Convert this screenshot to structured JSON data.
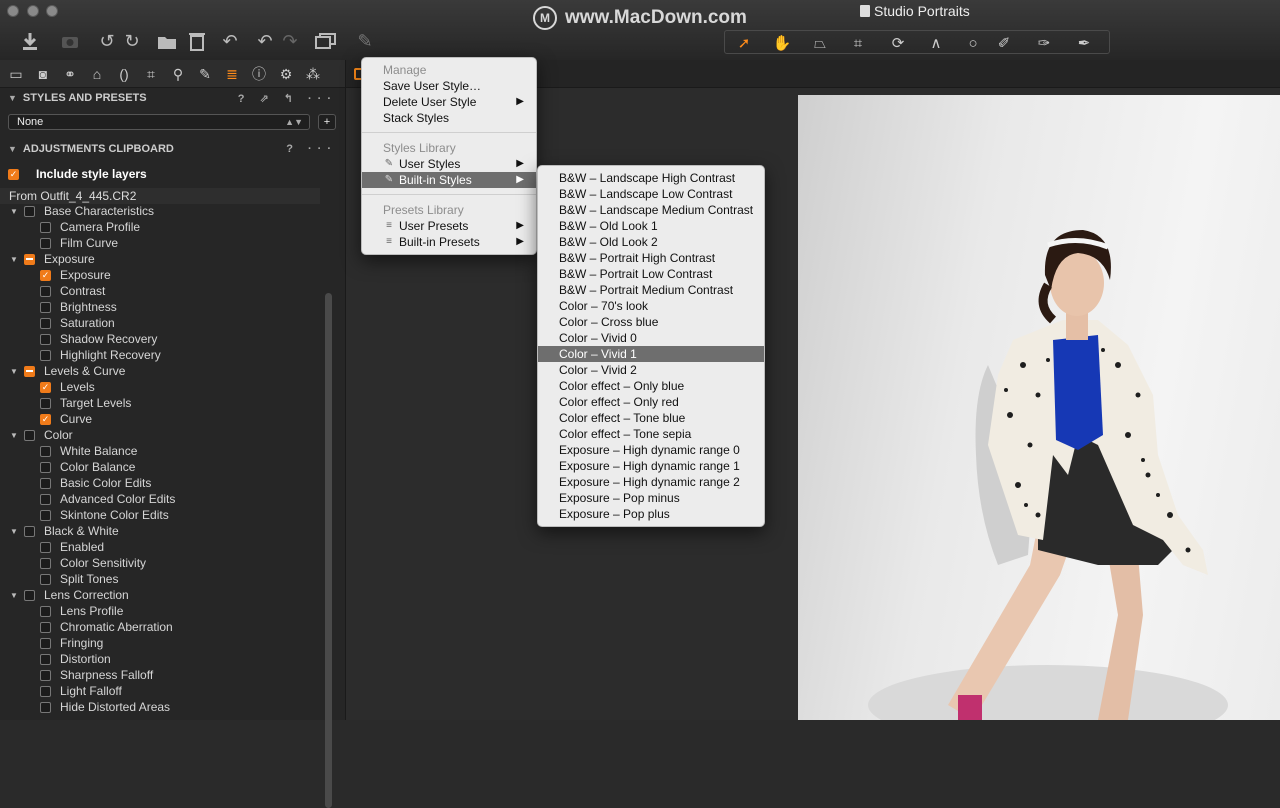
{
  "window": {
    "watermark": "www.MacDown.com",
    "watermark_logo": "M",
    "session_title": "Studio Portraits"
  },
  "toolbar_icons": [
    "import-icon",
    "camera-icon",
    "rotate-left-icon",
    "rotate-right-icon",
    "move-to-folder-icon",
    "trash-icon",
    "undo-icon",
    "undo-step-icon",
    "redo-icon",
    "copy-window-icon",
    "brush-icon"
  ],
  "cursor_tools": [
    "select-icon",
    "pan-icon",
    "keystone-icon",
    "crop-icon",
    "rotate-icon",
    "straighten-icon",
    "circle-icon",
    "draw-mask-icon",
    "erase-mask-icon",
    "picker-icon"
  ],
  "tool_tabs": [
    "folder-icon",
    "camera-icon",
    "color-icon",
    "exposure-icon",
    "lens-icon",
    "crop-icon",
    "details-icon",
    "adjustments-icon",
    "styles-icon",
    "metadata-icon",
    "settings-icon",
    "batch-icon"
  ],
  "styles_panel": {
    "header": "STYLES AND PRESETS",
    "header_icons": "? ⇗ ↰ ···",
    "selected": "None",
    "add_label": "+"
  },
  "clipboard_panel": {
    "header": "ADJUSTMENTS CLIPBOARD",
    "header_icons": "? ···",
    "include_label": "Include style layers",
    "from_label": "From Outfit_4_445.CR2",
    "tree": [
      {
        "label": "Base Characteristics",
        "state": "unchecked",
        "children": [
          {
            "label": "Camera Profile",
            "state": "unchecked"
          },
          {
            "label": "Film Curve",
            "state": "unchecked"
          }
        ]
      },
      {
        "label": "Exposure",
        "state": "partial",
        "children": [
          {
            "label": "Exposure",
            "state": "checked"
          },
          {
            "label": "Contrast",
            "state": "unchecked"
          },
          {
            "label": "Brightness",
            "state": "unchecked"
          },
          {
            "label": "Saturation",
            "state": "unchecked"
          },
          {
            "label": "Shadow Recovery",
            "state": "unchecked"
          },
          {
            "label": "Highlight Recovery",
            "state": "unchecked"
          }
        ]
      },
      {
        "label": "Levels & Curve",
        "state": "partial",
        "children": [
          {
            "label": "Levels",
            "state": "checked"
          },
          {
            "label": "Target Levels",
            "state": "unchecked"
          },
          {
            "label": "Curve",
            "state": "checked"
          }
        ]
      },
      {
        "label": "Color",
        "state": "unchecked",
        "children": [
          {
            "label": "White Balance",
            "state": "unchecked"
          },
          {
            "label": "Color Balance",
            "state": "unchecked"
          },
          {
            "label": "Basic Color Edits",
            "state": "unchecked"
          },
          {
            "label": "Advanced Color Edits",
            "state": "unchecked"
          },
          {
            "label": "Skintone Color Edits",
            "state": "unchecked"
          }
        ]
      },
      {
        "label": "Black & White",
        "state": "unchecked",
        "children": [
          {
            "label": "Enabled",
            "state": "unchecked"
          },
          {
            "label": "Color Sensitivity",
            "state": "unchecked"
          },
          {
            "label": "Split Tones",
            "state": "unchecked"
          }
        ]
      },
      {
        "label": "Lens Correction",
        "state": "unchecked",
        "children": [
          {
            "label": "Lens Profile",
            "state": "unchecked"
          },
          {
            "label": "Chromatic Aberration",
            "state": "unchecked"
          },
          {
            "label": "Fringing",
            "state": "unchecked"
          },
          {
            "label": "Distortion",
            "state": "unchecked"
          },
          {
            "label": "Sharpness Falloff",
            "state": "unchecked"
          },
          {
            "label": "Light Falloff",
            "state": "unchecked"
          },
          {
            "label": "Hide Distorted Areas",
            "state": "unchecked"
          }
        ]
      }
    ]
  },
  "menu": {
    "manage_header": "Manage",
    "save_user_style": "Save User Style…",
    "delete_user_style": "Delete User Style",
    "stack_styles": "Stack Styles",
    "styles_library_header": "Styles Library",
    "user_styles": "User Styles",
    "builtin_styles": "Built-in Styles",
    "presets_library_header": "Presets Library",
    "user_presets": "User Presets",
    "builtin_presets": "Built-in Presets",
    "submenu_arrow": "▶"
  },
  "builtin_styles_submenu": {
    "highlighted_index": 11,
    "items": [
      "B&W – Landscape High Contrast",
      "B&W – Landscape Low Contrast",
      "B&W – Landscape Medium Contrast",
      "B&W – Old Look 1",
      "B&W – Old Look 2",
      "B&W – Portrait High Contrast",
      "B&W – Portrait Low Contrast",
      "B&W – Portrait Medium Contrast",
      "Color – 70's look",
      "Color – Cross blue",
      "Color – Vivid 0",
      "Color – Vivid 1",
      "Color – Vivid 2",
      "Color effect – Only blue",
      "Color effect – Only red",
      "Color effect – Tone blue",
      "Color effect – Tone sepia",
      "Exposure – High dynamic range 0",
      "Exposure – High dynamic range 1",
      "Exposure – High dynamic range 2",
      "Exposure – Pop minus",
      "Exposure – Pop plus"
    ]
  }
}
